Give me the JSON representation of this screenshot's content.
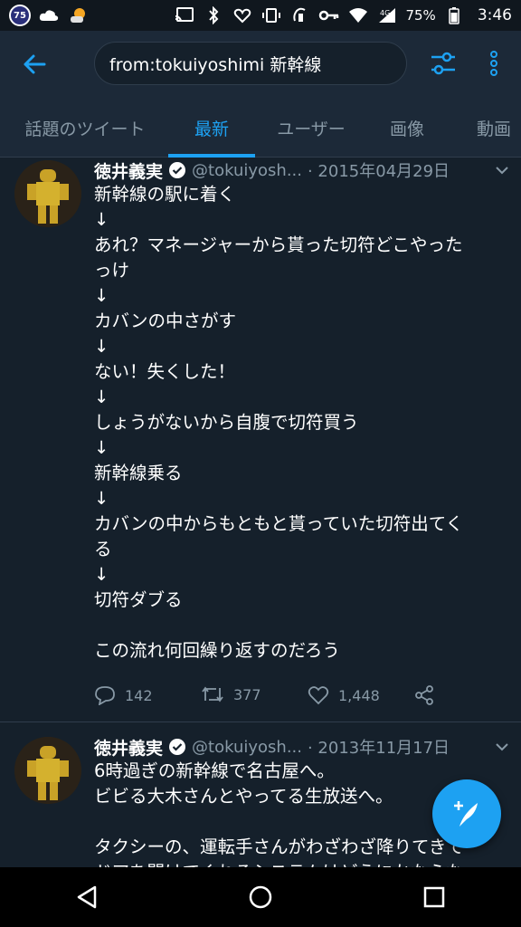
{
  "status_bar": {
    "badge": "75",
    "battery": "75%",
    "time": "3:46",
    "network": "4G"
  },
  "header": {
    "search_query": "from:tokuiyoshimi 新幹線"
  },
  "tabs": [
    {
      "label": "話題のツイート"
    },
    {
      "label": "最新"
    },
    {
      "label": "ユーザー"
    },
    {
      "label": "画像"
    },
    {
      "label": "動画"
    }
  ],
  "tweets": [
    {
      "name": "徳井義実",
      "handle": "@tokuiyosh...",
      "date": "· 2015年04月29日",
      "lines": [
        "新幹線の駅に着く",
        "↓",
        "あれ？マネージャーから貰った切符どこやった",
        "っけ",
        "↓",
        "カバンの中さがす",
        "↓",
        "ない！失くした！",
        "↓",
        "しょうがないから自腹で切符買う",
        "↓",
        "新幹線乗る",
        "↓",
        "カバンの中からもともと貰っていた切符出てく",
        "る",
        "↓",
        "切符ダブる",
        "",
        "この流れ何回繰り返すのだろう"
      ],
      "replies": "142",
      "retweets": "377",
      "likes": "1,448"
    },
    {
      "name": "徳井義実",
      "handle": "@tokuiyosh...",
      "date": "· 2013年11月17日",
      "lines": [
        "6時過ぎの新幹線で名古屋へ。",
        "ビビる大木さんとやってる生放送へ。",
        "",
        "タクシーの、運転手さんがわざわざ降りてきて",
        "ドアを開けてくれるシステムはどうにかならな"
      ]
    }
  ],
  "colors": {
    "background": "#15202b",
    "header": "#1c2938",
    "accent": "#1da1f2",
    "secondary_text": "#8899a6"
  }
}
